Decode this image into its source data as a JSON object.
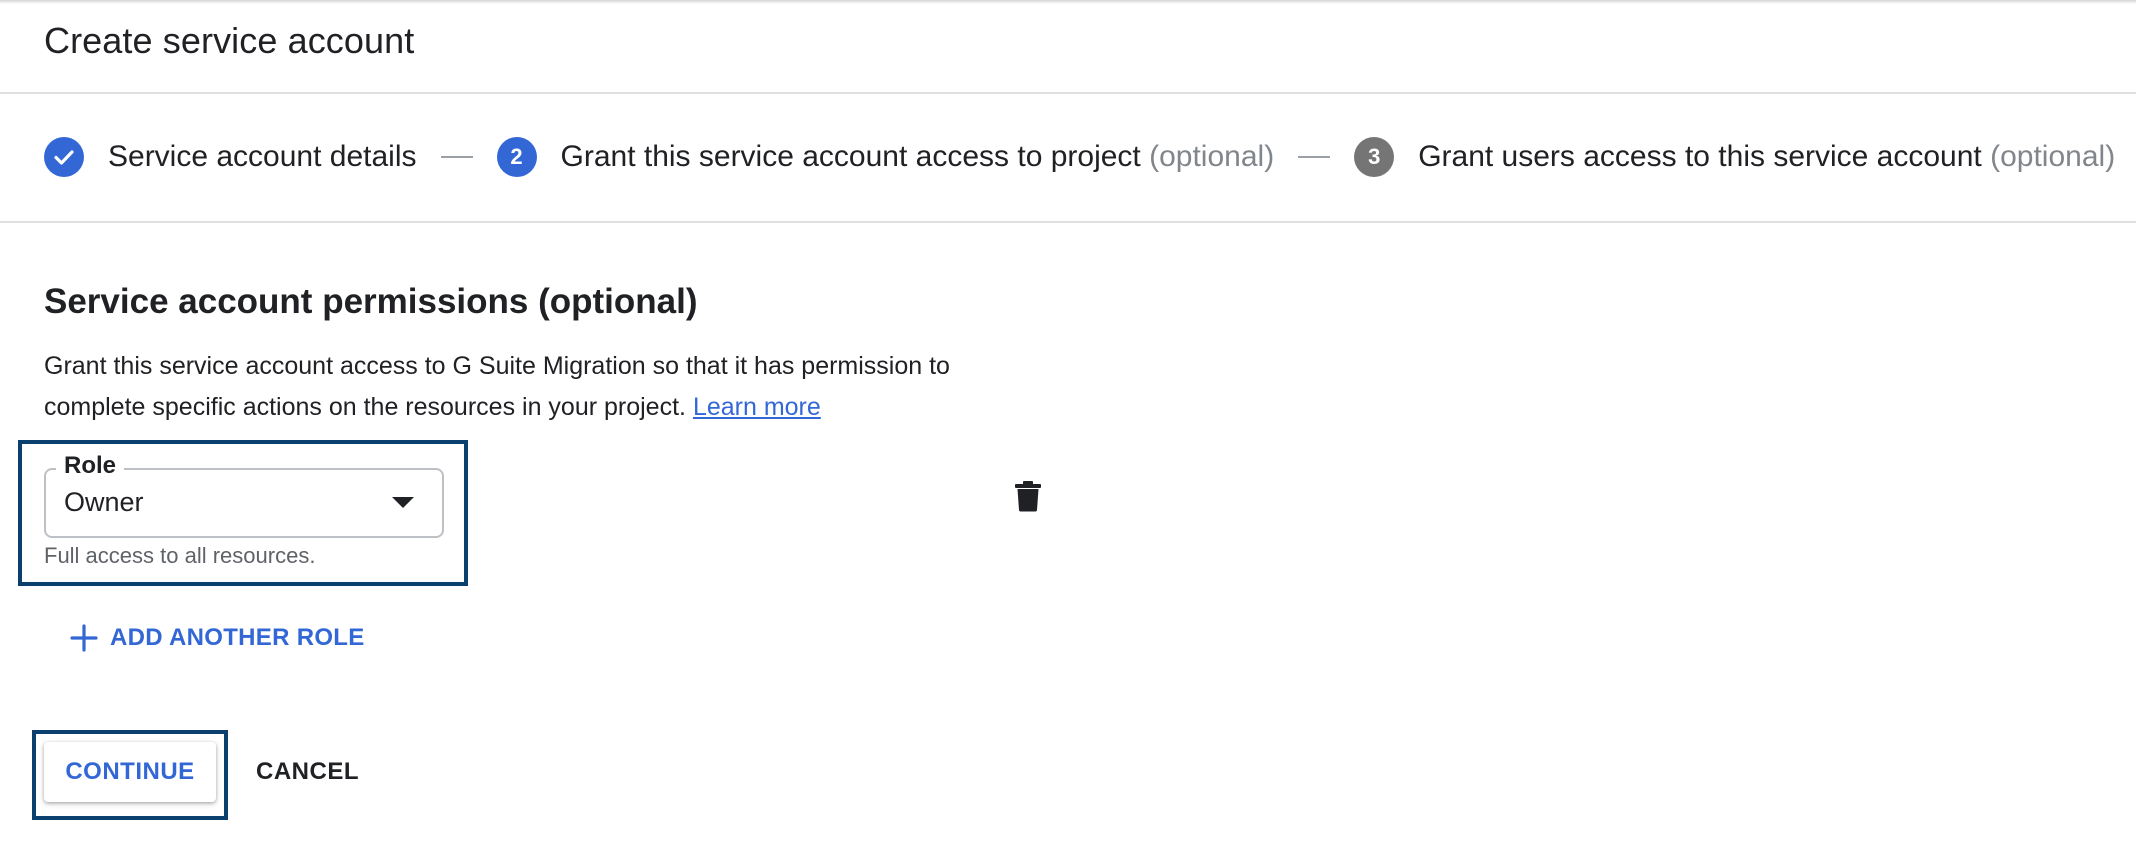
{
  "page": {
    "title": "Create service account"
  },
  "stepper": {
    "steps": [
      {
        "label": "Service account details",
        "optional": "",
        "state": "done",
        "icon": "check-icon"
      },
      {
        "number": "2",
        "label": "Grant this service account access to project",
        "optional": "(optional)",
        "state": "active"
      },
      {
        "number": "3",
        "label": "Grant users access to this service account",
        "optional": "(optional)",
        "state": "inactive"
      }
    ]
  },
  "permissions": {
    "title": "Service account permissions (optional)",
    "description_line1": "Grant this service account access to G Suite Migration so that it has permission to",
    "description_line2": "complete specific actions on the resources in your project.",
    "learn_more": "Learn more",
    "role": {
      "legend": "Role",
      "value": "Owner",
      "hint": "Full access to all resources.",
      "delete_icon": "trash-icon",
      "dropdown_icon": "caret-down-icon"
    },
    "add_role_label": "ADD ANOTHER ROLE"
  },
  "actions": {
    "continue_label": "CONTINUE",
    "cancel_label": "CANCEL"
  },
  "colors": {
    "accent": "#3367d6",
    "step_inactive": "#757575",
    "highlight_border": "#0b3f6e",
    "divider": "#e0e0e0"
  }
}
